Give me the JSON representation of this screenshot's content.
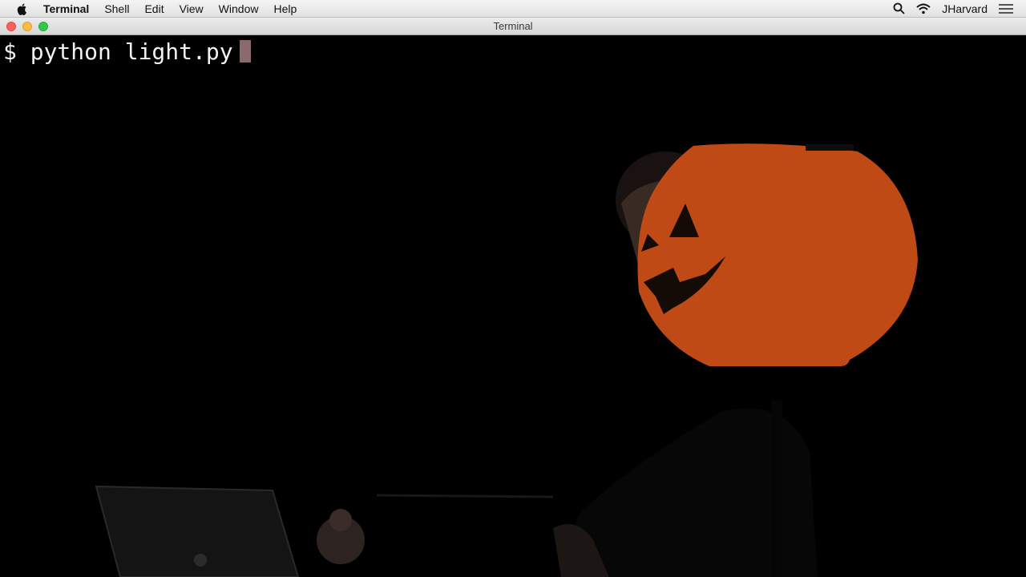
{
  "menubar": {
    "app_name": "Terminal",
    "items": [
      "Shell",
      "Edit",
      "View",
      "Window",
      "Help"
    ],
    "user": "JHarvard",
    "icons": [
      "apple-icon",
      "search-icon",
      "wifi-icon",
      "list-icon"
    ]
  },
  "window": {
    "title": "Terminal"
  },
  "terminal": {
    "prompt": "$",
    "command": "python light.py"
  },
  "colors": {
    "pumpkin": "#bf4a16",
    "background": "#000000"
  }
}
